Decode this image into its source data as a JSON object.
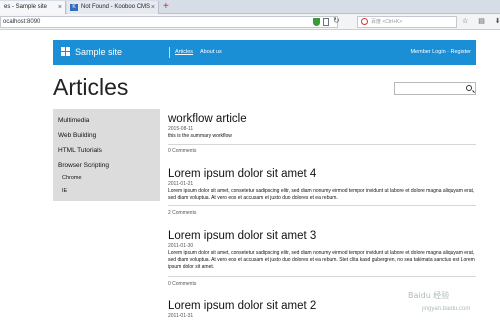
{
  "browser": {
    "tabs": [
      {
        "label": "es - Sample site"
      },
      {
        "label": "Not Found - Kooboo CMS"
      }
    ],
    "new_tab": "+",
    "url": "ocalhost:8090",
    "search_placeholder": "百度 <Ctrl+K>",
    "close_glyph": "×"
  },
  "site": {
    "title": "Sample site",
    "nav": [
      "Articles",
      "About us"
    ],
    "member": "Member Login · Register",
    "accent": "#1a8fd6"
  },
  "page": {
    "title": "Articles"
  },
  "sidebar": {
    "items": [
      {
        "label": "Multimedia"
      },
      {
        "label": "Web Building"
      },
      {
        "label": "HTML Tutorials"
      },
      {
        "label": "Browser Scripting"
      }
    ],
    "subitems": [
      {
        "label": "Chrome"
      },
      {
        "label": "IE"
      }
    ]
  },
  "articles": [
    {
      "title": "workflow article",
      "date": "2015-08-11",
      "summary": "this is the summary workflow",
      "comments": "0 Comments"
    },
    {
      "title": "Lorem ipsum dolor sit amet 4",
      "date": "2011-01-21",
      "summary": "Lorem ipsum dolor sit amet, consetetur sadipscing elitr, sed diam nonumy eirmod tempor invidunt ut labore et dolore magna aliquyam erat, sed diam voluptua. At vero eos et accusam et justo duo dolores et ea rebum.",
      "comments": "2 Comments"
    },
    {
      "title": "Lorem ipsum dolor sit amet 3",
      "date": "2011-01-30",
      "summary": "Lorem ipsum dolor sit amet, consetetur sadipscing elitr, sed diam nonumy eirmod tempor invidunt ut labore et dolore magna aliquyam erat, sed diam voluptua. At vero eos et accusam et justo duo dolores et ea rebum. Stet clita kasd gubergren, no sea takimata sanctus est Lorem ipsum dolor sit amet.",
      "comments": "0 Comments"
    },
    {
      "title": "Lorem ipsum dolor sit amet 2",
      "date": "2011-01-31"
    }
  ],
  "watermark": {
    "line1": "Baidu 经验",
    "line2": "jingyan.baidu.com"
  }
}
